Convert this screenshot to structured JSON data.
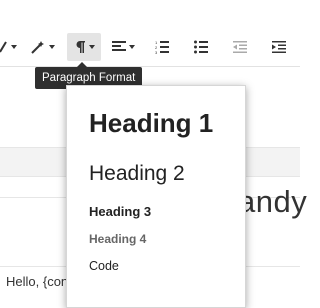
{
  "toolbar": {
    "paragraph_format_tooltip": "Paragraph Format",
    "active_color": "#e4e4e4"
  },
  "editor": {
    "background_heading_fragment": "andy",
    "body_line": "Hello, {contact.name}!"
  },
  "paragraph_menu": {
    "items": [
      {
        "label": "Heading 1"
      },
      {
        "label": "Heading 2"
      },
      {
        "label": "Heading 3"
      },
      {
        "label": "Heading 4"
      },
      {
        "label": "Code"
      }
    ]
  },
  "icons": [
    "text-color-icon",
    "magic-wand-icon",
    "pilcrow-icon",
    "align-left-icon",
    "ordered-list-icon",
    "unordered-list-icon",
    "outdent-icon",
    "indent-icon"
  ]
}
